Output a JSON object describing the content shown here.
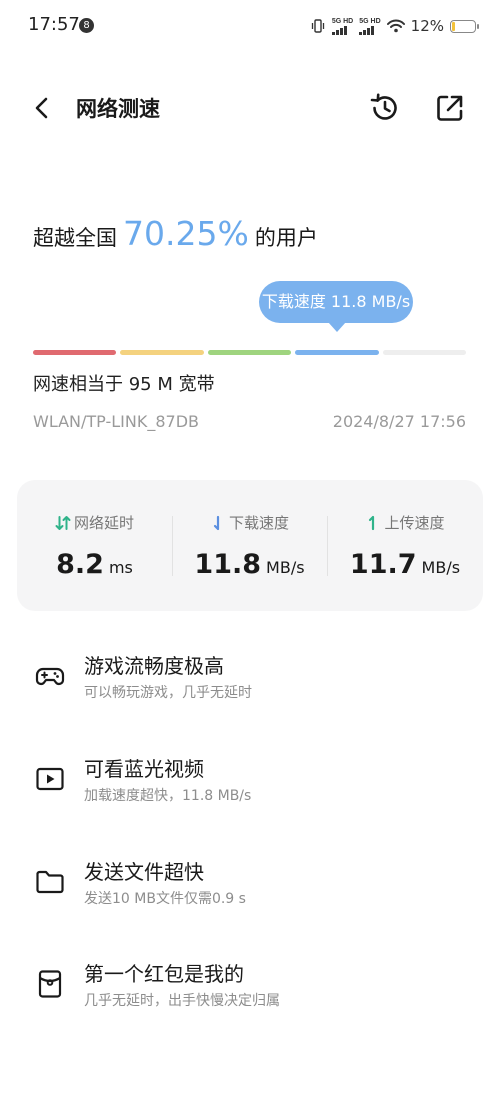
{
  "status_bar": {
    "time": "17:57",
    "badge": "8",
    "sim1_label": "5G HD",
    "sim2_label": "5G HD",
    "battery_pct": "12%",
    "battery_level": 0.12,
    "icons": [
      "vibrate-icon",
      "signal-icon",
      "wifi-icon",
      "battery-icon"
    ]
  },
  "header": {
    "title": "网络测速",
    "icons": [
      "back-arrow-icon",
      "history-icon",
      "share-icon"
    ]
  },
  "summary": {
    "prefix": "超越全国",
    "percentile": "70.25%",
    "suffix": "的用户",
    "tooltip": "下载速度 11.8 MB/s",
    "bandwidth": "网速相当于 95 M 宽带",
    "network": "WLAN/TP-LINK_87DB",
    "timestamp": "2024/8/27 17:56",
    "segment_colors": [
      "#e06a70",
      "#f4d27f",
      "#9fd47f",
      "#7bb2ee",
      "#eeeeee"
    ]
  },
  "metrics": {
    "latency": {
      "label": "网络延时",
      "value": "8.2",
      "unit": "ms"
    },
    "download": {
      "label": "下载速度",
      "value": "11.8",
      "unit": "MB/s"
    },
    "upload": {
      "label": "上传速度",
      "value": "11.7",
      "unit": "MB/s"
    }
  },
  "features": [
    {
      "title": "游戏流畅度极高",
      "subtitle": "可以畅玩游戏，几乎无延时",
      "icon": "gamepad-icon"
    },
    {
      "title": "可看蓝光视频",
      "subtitle": "加载速度超快，11.8 MB/s",
      "icon": "video-play-icon"
    },
    {
      "title": "发送文件超快",
      "subtitle": "发送10 MB文件仅需0.9 s",
      "icon": "folder-icon"
    },
    {
      "title": "第一个红包是我的",
      "subtitle": "几乎无延时，出手快慢决定归属",
      "icon": "red-envelope-icon"
    }
  ],
  "colors": {
    "accent": "#6aa9ec",
    "latency_icon": "#2fb38a",
    "download_icon": "#5b8fe0",
    "upload_icon": "#2fb38a"
  }
}
